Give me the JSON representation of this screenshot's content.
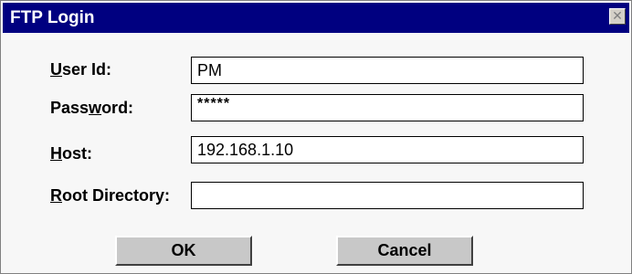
{
  "window": {
    "title": "FTP Login",
    "close_glyph": "✕"
  },
  "form": {
    "user_id": {
      "label_accel": "U",
      "label_rest": "ser Id:",
      "value": "PM"
    },
    "password": {
      "label_pre": "Pass",
      "label_accel": "w",
      "label_rest": "ord:",
      "value": "*****"
    },
    "host": {
      "label_accel": "H",
      "label_rest": "ost:",
      "value": "192.168.1.10"
    },
    "root_directory": {
      "label_accel": "R",
      "label_rest": "oot Directory:",
      "value": ""
    }
  },
  "buttons": {
    "ok_label": "OK",
    "cancel_label": "Cancel"
  },
  "colors": {
    "title_bar": "#000080",
    "dialog_background": "#f7f7f7",
    "button_face": "#c8c8c8"
  }
}
